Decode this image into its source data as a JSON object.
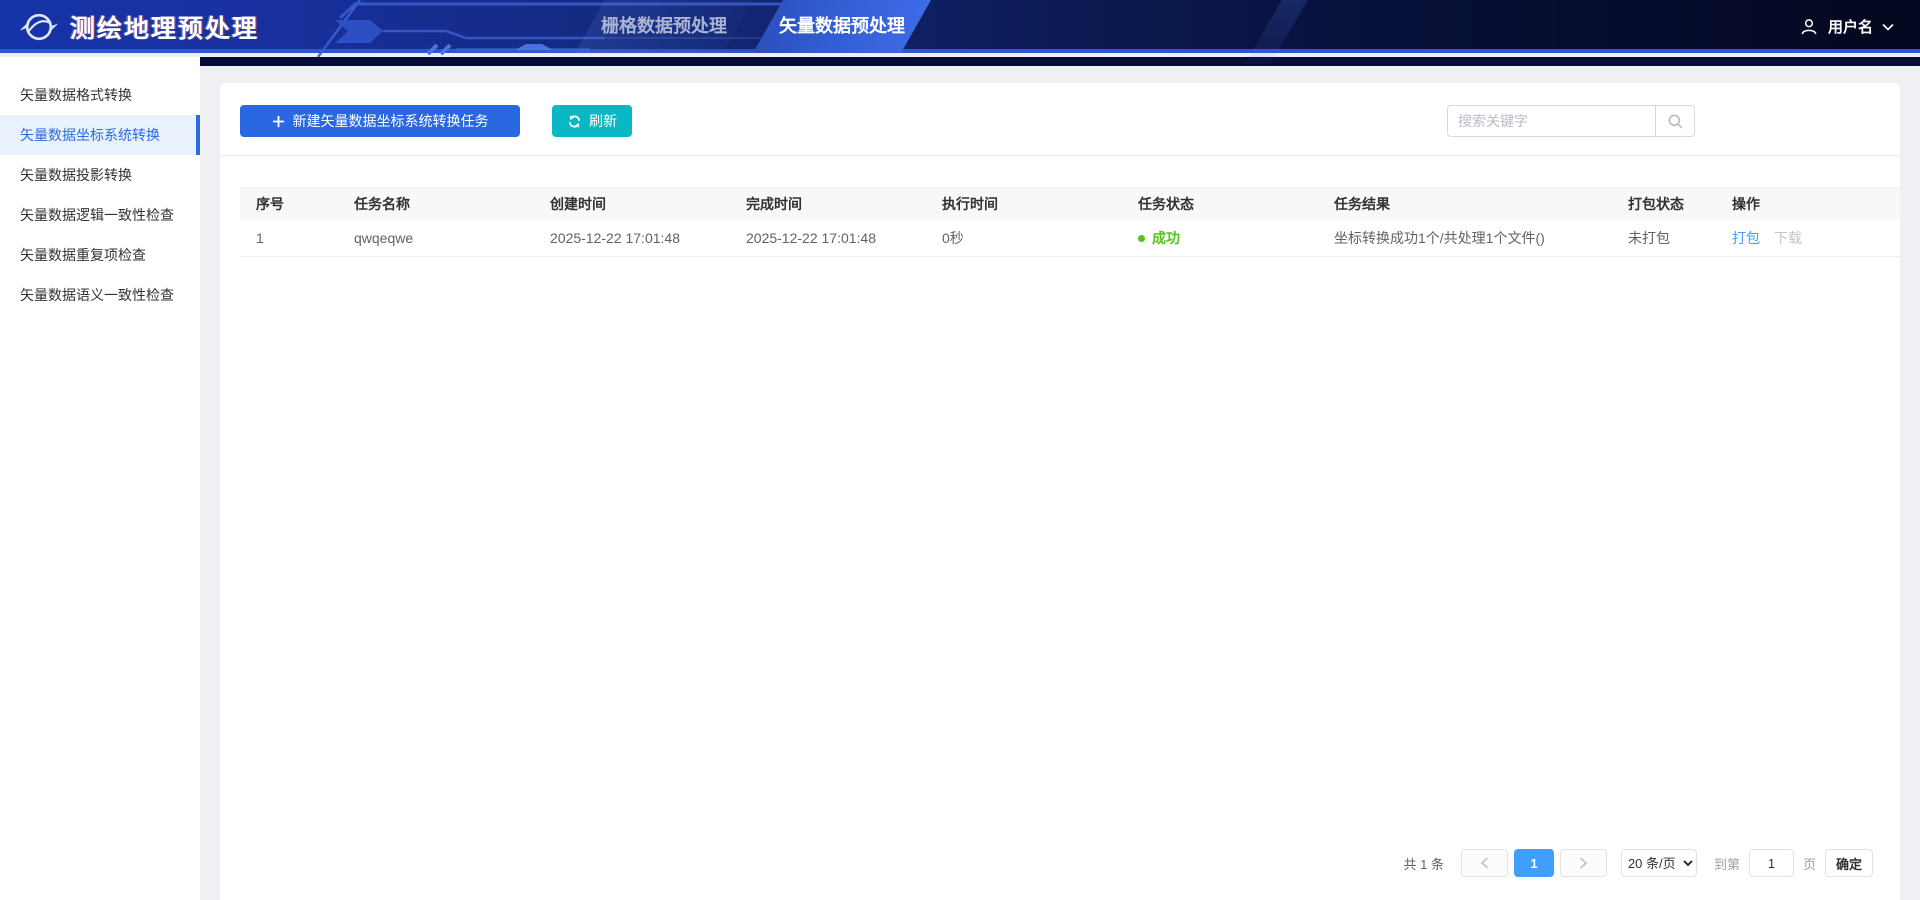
{
  "header": {
    "app_title": "测绘地理预处理",
    "tabs": [
      {
        "label": "栅格数据预处理",
        "active": false
      },
      {
        "label": "矢量数据预处理",
        "active": true
      }
    ],
    "username": "用户名"
  },
  "sidebar": {
    "items": [
      {
        "label": "矢量数据格式转换",
        "active": false
      },
      {
        "label": "矢量数据坐标系统转换",
        "active": true
      },
      {
        "label": "矢量数据投影转换",
        "active": false
      },
      {
        "label": "矢量数据逻辑一致性检查",
        "active": false
      },
      {
        "label": "矢量数据重复项检查",
        "active": false
      },
      {
        "label": "矢量数据语义一致性检查",
        "active": false
      }
    ]
  },
  "toolbar": {
    "new_task_label": "新建矢量数据坐标系统转换任务",
    "refresh_label": "刷新",
    "search_placeholder": "搜索关键字"
  },
  "table": {
    "columns": [
      "序号",
      "任务名称",
      "创建时间",
      "完成时间",
      "执行时间",
      "任务状态",
      "任务结果",
      "打包状态",
      "操作"
    ],
    "rows": [
      {
        "index": "1",
        "name": "qwqeqwe",
        "created": "2025-12-22 17:01:48",
        "finished": "2025-12-22 17:01:48",
        "duration": "0秒",
        "status": "成功",
        "result": "坐标转换成功1个/共处理1个文件()",
        "package_status": "未打包",
        "action_package": "打包",
        "action_download": "下载"
      }
    ]
  },
  "pagination": {
    "total": "共 1 条",
    "current_page": "1",
    "page_size": "20 条/页",
    "goto_prefix": "到第",
    "goto_value": "1",
    "goto_suffix": "页",
    "confirm": "确定"
  },
  "icons": {
    "logo": "globe-emblem",
    "user": "person-outline",
    "chevron_down": "⌄",
    "plus": "+",
    "refresh": "circular-arrows ⟳",
    "search": "magnifier",
    "prev": "‹",
    "next": "›",
    "status_dot": "●"
  },
  "colors": {
    "header_gradient_left": "#1634a8",
    "header_gradient_right": "#04081f",
    "header_bottom_line": "#2b57d5",
    "active_tab_blue": "#3461d8",
    "primary_button_blue": "#2968e0",
    "refresh_teal": "#0ab8c4",
    "sidebar_active_bg": "#e9f1fd",
    "sidebar_active_text": "#2b6be0",
    "success_green": "#52c41a",
    "link_blue": "#409eff",
    "disabled_gray": "#c0c4cc",
    "active_page_bg": "#409eff",
    "app_background": "#eef0f4"
  }
}
